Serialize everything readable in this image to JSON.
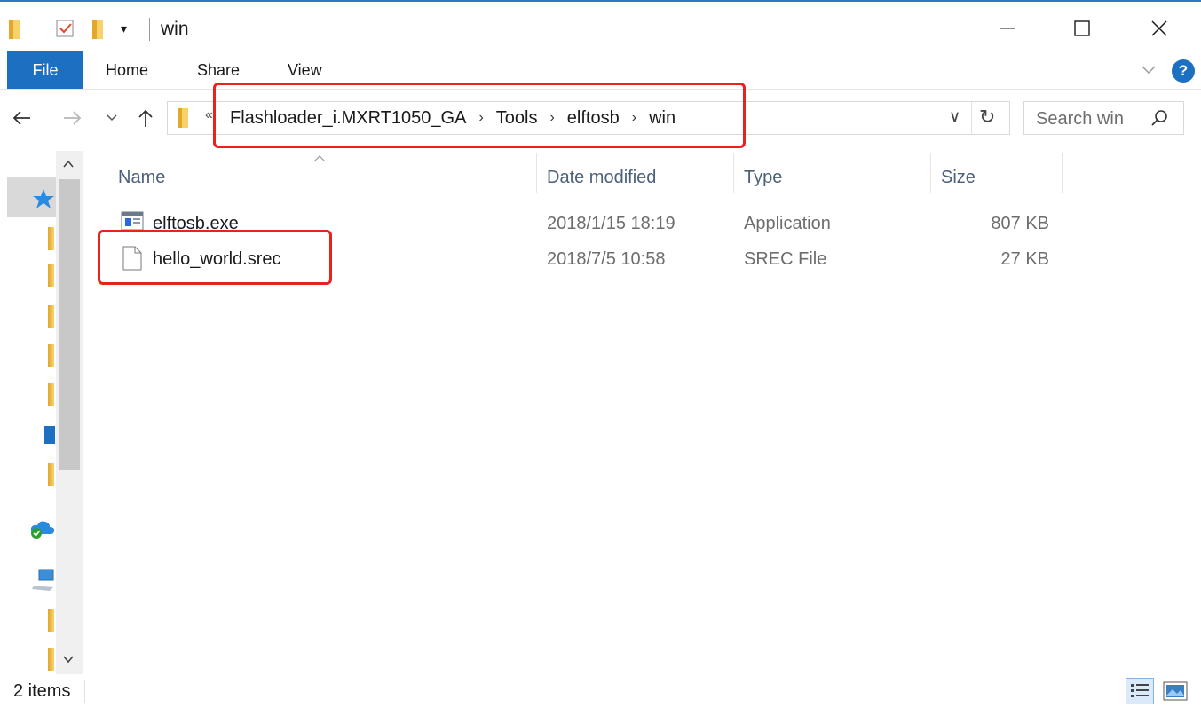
{
  "window": {
    "title": "win",
    "controls": {
      "minimize": "—",
      "maximize": "☐",
      "close": "✕"
    }
  },
  "ribbon": {
    "tabs": [
      "File",
      "Home",
      "Share",
      "View"
    ],
    "help": "?"
  },
  "address_bar": {
    "overflow_glyph": "«",
    "segments": [
      "Flashloader_i.MXRT1050_GA",
      "Tools",
      "elftosb",
      "win"
    ],
    "separator": "›",
    "refresh_glyph": "↻",
    "dropdown_glyph": "∨"
  },
  "search": {
    "placeholder": "Search win"
  },
  "file_list": {
    "columns": {
      "name": "Name",
      "date": "Date modified",
      "type": "Type",
      "size": "Size"
    },
    "rows": [
      {
        "name": "elftosb.exe",
        "date": "2018/1/15 18:19",
        "type": "Application",
        "size": "807 KB",
        "icon": "application-icon"
      },
      {
        "name": "hello_world.srec",
        "date": "2018/7/5 10:58",
        "type": "SREC File",
        "size": "27 KB",
        "icon": "file-icon"
      }
    ]
  },
  "status_bar": {
    "item_count": "2 items"
  },
  "colors": {
    "accent": "#1d6fc2",
    "highlight": "#e8231f",
    "folder": "#f2c14e"
  }
}
